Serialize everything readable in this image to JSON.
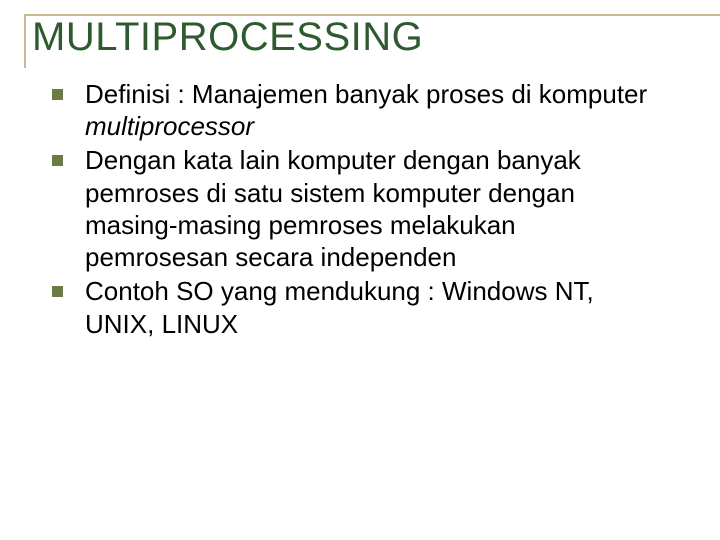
{
  "slide": {
    "title": "MULTIPROCESSING",
    "bullets": [
      {
        "pre": "Definisi : Manajemen banyak proses di komputer ",
        "italic": "multiprocessor",
        "post": ""
      },
      {
        "pre": "Dengan kata lain komputer dengan banyak pemroses di satu sistem komputer dengan masing-masing pemroses melakukan pemrosesan secara independen",
        "italic": "",
        "post": ""
      },
      {
        "pre": "Contoh SO yang mendukung : Windows NT, UNIX, LINUX",
        "italic": "",
        "post": ""
      }
    ]
  }
}
